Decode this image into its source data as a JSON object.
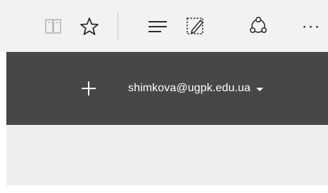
{
  "toolbar": {
    "buttons": [
      {
        "icon": "reading-view-icon"
      },
      {
        "icon": "favorite-star-icon"
      },
      {
        "icon": "hub-icon"
      },
      {
        "icon": "web-note-icon"
      },
      {
        "icon": "share-icon"
      },
      {
        "icon": "more-icon"
      }
    ],
    "more_glyph": "···"
  },
  "site_header": {
    "background": "#474747",
    "user_email": "shimkova@ugpk.edu.ua"
  },
  "colors": {
    "toolbar_bg": "#f2f2f2",
    "content_bg": "#eeeeee",
    "icon_dark": "#2b2b2b",
    "icon_disabled": "#b5b5b5"
  }
}
